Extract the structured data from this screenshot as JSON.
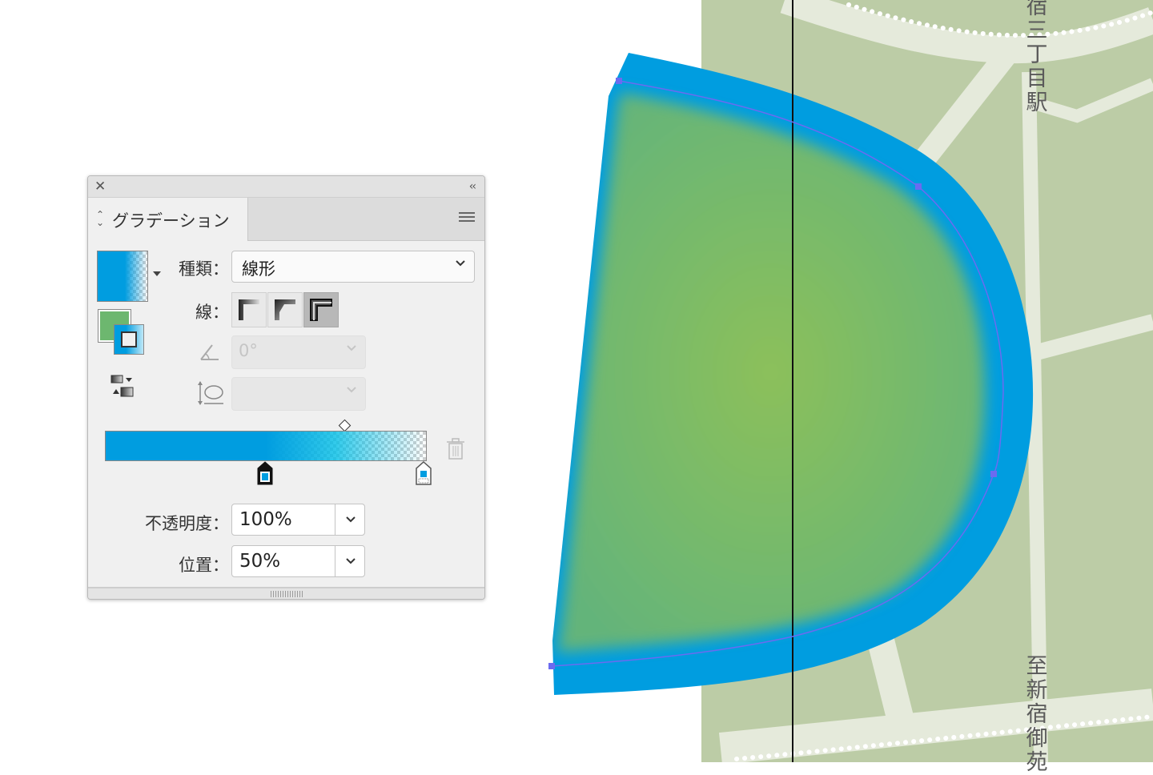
{
  "map": {
    "station_label": "宿三丁目駅",
    "direction_label": "至新宿御苑"
  },
  "panel": {
    "title": "グラデーション",
    "type_label": "種類：",
    "type_value": "線形",
    "stroke_label": "線：",
    "angle_value": "0°",
    "opacity_label": "不透明度：",
    "opacity_value": "100%",
    "position_label": "位置：",
    "position_value": "50%",
    "gradient_stops": [
      {
        "color": "#009de0",
        "location_percent": 50,
        "opacity_percent": 100
      },
      {
        "color": "#009de0",
        "location_percent": 100,
        "opacity_percent": 0
      }
    ],
    "midpoint_percent": 75
  },
  "colors": {
    "accent_blue": "#009de0",
    "fill_green": "#6db76f",
    "map_green": "#bccca6",
    "map_road": "#e5eadb"
  },
  "icons": {
    "close": "close-icon",
    "collapse": "double-chevron-left-icon",
    "menu": "hamburger-menu-icon",
    "trash": "trash-icon",
    "angle": "angle-icon",
    "aspect": "aspect-ratio-icon",
    "reverse": "reverse-gradient-icon"
  }
}
